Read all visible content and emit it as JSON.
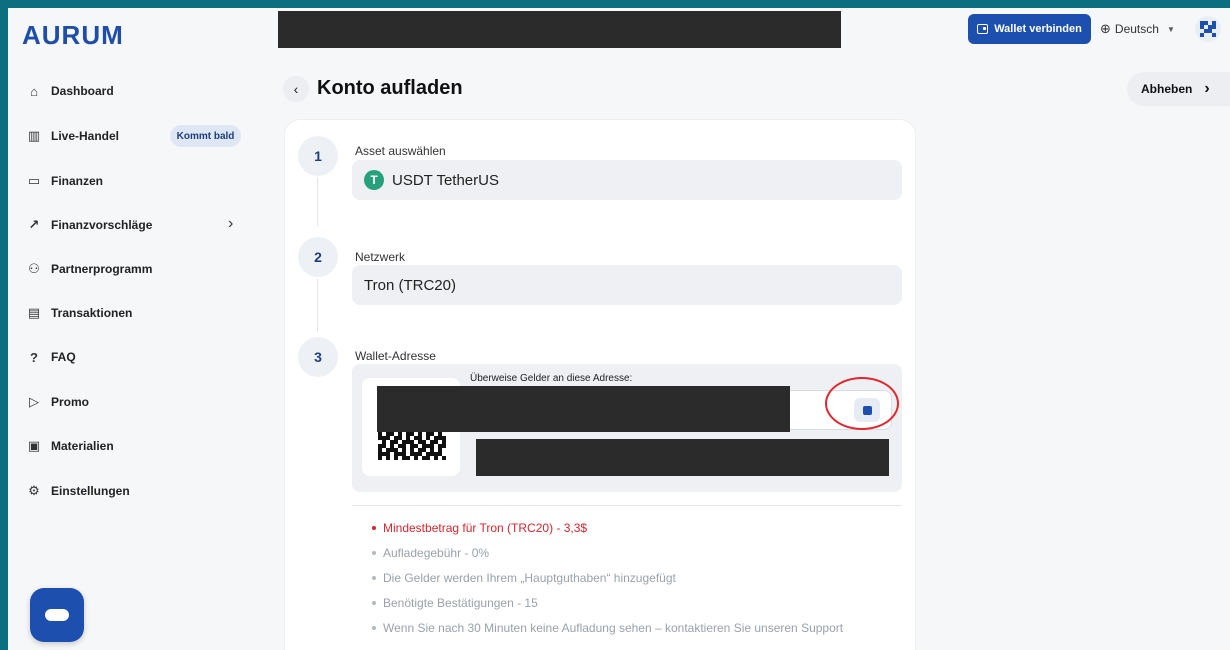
{
  "app": {
    "logo": "AURUM"
  },
  "header": {
    "connect_label": "Wallet verbinden",
    "language": "Deutsch"
  },
  "sidebar": {
    "items": [
      {
        "label": "Dashboard",
        "icon": "home-icon"
      },
      {
        "label": "Live-Handel",
        "icon": "bar-chart-icon",
        "badge": "Kommt bald"
      },
      {
        "label": "Finanzen",
        "icon": "wallet-icon"
      },
      {
        "label": "Finanzvorschläge",
        "icon": "trend-icon",
        "has_submenu": true
      },
      {
        "label": "Partnerprogramm",
        "icon": "people-icon"
      },
      {
        "label": "Transaktionen",
        "icon": "document-icon"
      },
      {
        "label": "FAQ",
        "icon": "question-icon"
      },
      {
        "label": "Promo",
        "icon": "promo-icon"
      },
      {
        "label": "Materialien",
        "icon": "materials-icon"
      },
      {
        "label": "Einstellungen",
        "icon": "gear-icon"
      }
    ]
  },
  "page": {
    "title": "Konto aufladen",
    "withdraw_label": "Abheben"
  },
  "steps": [
    {
      "number": "1",
      "label": "Asset auswählen",
      "value": "USDT TetherUS",
      "icon_letter": "T"
    },
    {
      "number": "2",
      "label": "Netzwerk",
      "value": "Tron (TRC20)"
    },
    {
      "number": "3",
      "label": "Wallet-Adresse",
      "caption": "Überweise Gelder an diese Adresse:"
    }
  ],
  "notes": [
    {
      "text": "Mindestbetrag für Tron (TRC20) - 3,3$",
      "warning": true
    },
    {
      "text": "Aufladegebühr - 0%"
    },
    {
      "text": "Die Gelder werden Ihrem „Hauptguthaben“ hinzugefügt"
    },
    {
      "text": "Benötigte Bestätigungen - 15"
    },
    {
      "text": "Wenn Sie nach 30 Minuten keine Aufladung sehen – kontaktieren Sie unseren Support"
    }
  ],
  "colors": {
    "brand": "#1d4fae",
    "warning": "#d4262f",
    "annotation": "#e1262d",
    "tether": "#26a17b"
  }
}
